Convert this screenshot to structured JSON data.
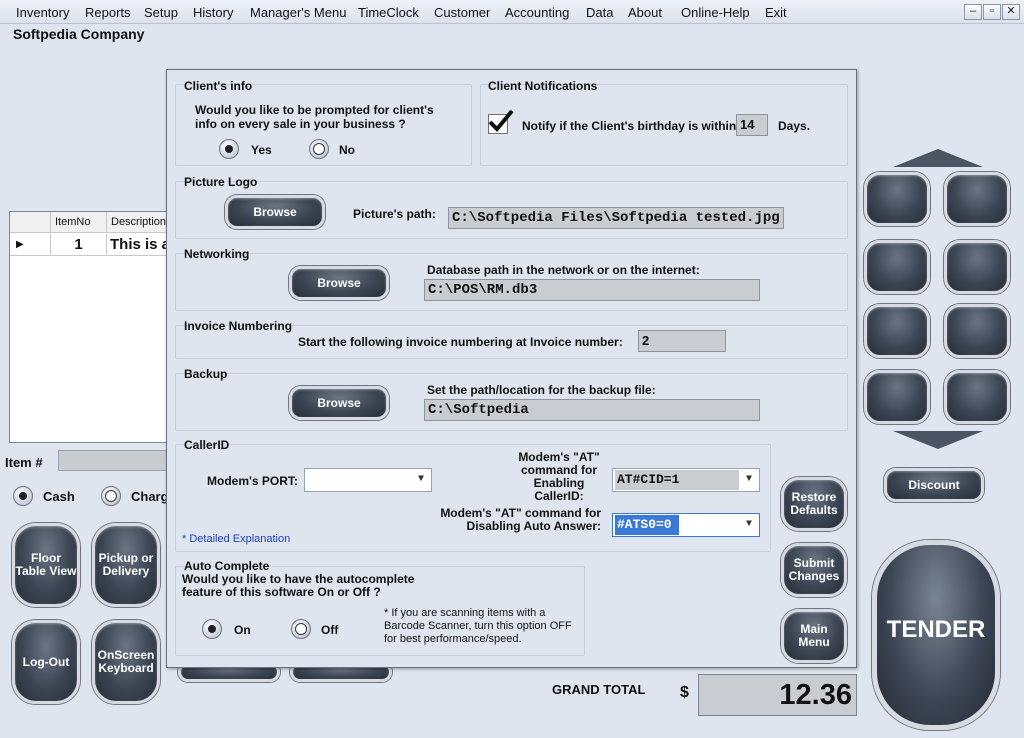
{
  "menu": [
    "Inventory",
    "Reports",
    "Setup",
    "History",
    "Manager's Menu",
    "TimeClock",
    "Customer",
    "Accounting",
    "Data",
    "About",
    "Online-Help",
    "Exit"
  ],
  "window_controls": {
    "minimize": "–",
    "restore": "▫",
    "close": "✕"
  },
  "company_name": "Softpedia Company",
  "grid": {
    "headers": [
      "ItemNo",
      "Description"
    ],
    "row": {
      "item_no": "1",
      "description": "This is a"
    }
  },
  "item_label": "Item #",
  "payment": {
    "cash": "Cash",
    "charge": "Charg"
  },
  "left_buttons": {
    "floor_table": "Floor Table View",
    "pickup": "Pickup or Delivery",
    "logout": "Log-Out",
    "keyboard": "OnScreen Keyboard"
  },
  "dialog": {
    "clients_info": {
      "title": "Client's info",
      "question": "Would you like to be prompted for client's info on every sale in your business ?",
      "yes": "Yes",
      "no": "No"
    },
    "notifications": {
      "title": "Client Notifications",
      "text": "Notify if the Client's birthday is within",
      "days_value": "14",
      "days_label": "Days."
    },
    "picture_logo": {
      "title": "Picture Logo",
      "browse": "Browse",
      "path_label": "Picture's path:",
      "path_value": "C:\\Softpedia Files\\Softpedia tested.jpg"
    },
    "networking": {
      "title": "Networking",
      "browse": "Browse",
      "label": "Database path in the network or on the internet:",
      "value": "C:\\POS\\RM.db3"
    },
    "invoice": {
      "title": "Invoice Numbering",
      "label": "Start the following  invoice numbering at Invoice number:",
      "value": "2"
    },
    "backup": {
      "title": "Backup",
      "browse": "Browse",
      "label": "Set the path/location for the backup file:",
      "value": "C:\\Softpedia"
    },
    "callerid": {
      "title": "CallerID",
      "port_label": "Modem's PORT:",
      "port_value": "",
      "enable_label_1": "Modem's \"AT\"",
      "enable_label_2": "command for",
      "enable_label_3": "Enabling CallerID:",
      "enable_value": "AT#CID=1",
      "disable_label_1": "Modem's \"AT\" command for",
      "disable_label_2": "Disabling Auto Answer:",
      "disable_value": "#ATS0=0",
      "link": "* Detailed Explanation"
    },
    "autocomplete": {
      "title": "Auto Complete",
      "question": "Would you like to have the autocomplete feature of this software On or Off ?",
      "on": "On",
      "off": "Off",
      "note": "* If you are scanning items with a Barcode Scanner, turn this option OFF for best performance/speed."
    },
    "buttons": {
      "restore": "Restore Defaults",
      "submit": "Submit Changes",
      "main_menu": "Main Menu"
    }
  },
  "discount": "Discount",
  "tender": "TENDER",
  "grand_total": {
    "label": "GRAND TOTAL",
    "currency": "$",
    "value": "12.36"
  }
}
